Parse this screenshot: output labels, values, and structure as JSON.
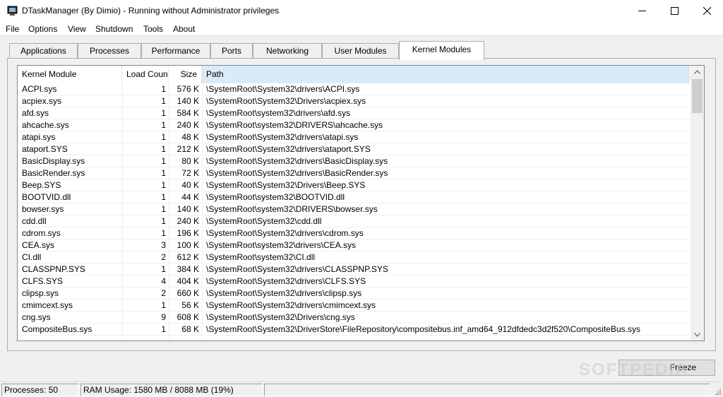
{
  "window": {
    "title": "DTaskManager (By Dimio) - Running without Administrator privileges",
    "icon": "app-icon"
  },
  "menu": [
    "File",
    "Options",
    "View",
    "Shutdown",
    "Tools",
    "About"
  ],
  "tabs": [
    "Applications",
    "Processes",
    "Performance",
    "Ports",
    "Networking",
    "User Modules",
    "Kernel Modules"
  ],
  "active_tab": "Kernel Modules",
  "list": {
    "columns": [
      "Kernel Module",
      "Load Count",
      "Size",
      "Path"
    ],
    "sorted_column": "Path",
    "rows": [
      [
        "ACPI.sys",
        "1",
        "576 K",
        "\\SystemRoot\\System32\\drivers\\ACPI.sys"
      ],
      [
        "acpiex.sys",
        "1",
        "140 K",
        "\\SystemRoot\\System32\\Drivers\\acpiex.sys"
      ],
      [
        "afd.sys",
        "1",
        "584 K",
        "\\SystemRoot\\system32\\drivers\\afd.sys"
      ],
      [
        "ahcache.sys",
        "1",
        "240 K",
        "\\SystemRoot\\system32\\DRIVERS\\ahcache.sys"
      ],
      [
        "atapi.sys",
        "1",
        "48 K",
        "\\SystemRoot\\System32\\drivers\\atapi.sys"
      ],
      [
        "ataport.SYS",
        "1",
        "212 K",
        "\\SystemRoot\\System32\\drivers\\ataport.SYS"
      ],
      [
        "BasicDisplay.sys",
        "1",
        "80 K",
        "\\SystemRoot\\System32\\drivers\\BasicDisplay.sys"
      ],
      [
        "BasicRender.sys",
        "1",
        "72 K",
        "\\SystemRoot\\System32\\drivers\\BasicRender.sys"
      ],
      [
        "Beep.SYS",
        "1",
        "40 K",
        "\\SystemRoot\\System32\\Drivers\\Beep.SYS"
      ],
      [
        "BOOTVID.dll",
        "1",
        "44 K",
        "\\SystemRoot\\system32\\BOOTVID.dll"
      ],
      [
        "bowser.sys",
        "1",
        "140 K",
        "\\SystemRoot\\system32\\DRIVERS\\bowser.sys"
      ],
      [
        "cdd.dll",
        "1",
        "240 K",
        "\\SystemRoot\\System32\\cdd.dll"
      ],
      [
        "cdrom.sys",
        "1",
        "196 K",
        "\\SystemRoot\\System32\\drivers\\cdrom.sys"
      ],
      [
        "CEA.sys",
        "3",
        "100 K",
        "\\SystemRoot\\system32\\drivers\\CEA.sys"
      ],
      [
        "CI.dll",
        "2",
        "612 K",
        "\\SystemRoot\\system32\\CI.dll"
      ],
      [
        "CLASSPNP.SYS",
        "1",
        "384 K",
        "\\SystemRoot\\System32\\drivers\\CLASSPNP.SYS"
      ],
      [
        "CLFS.SYS",
        "4",
        "404 K",
        "\\SystemRoot\\System32\\drivers\\CLFS.SYS"
      ],
      [
        "clipsp.sys",
        "2",
        "660 K",
        "\\SystemRoot\\System32\\drivers\\clipsp.sys"
      ],
      [
        "cmimcext.sys",
        "1",
        "56 K",
        "\\SystemRoot\\System32\\drivers\\cmimcext.sys"
      ],
      [
        "cng.sys",
        "9",
        "608 K",
        "\\SystemRoot\\System32\\Drivers\\cng.sys"
      ],
      [
        "CompositeBus.sys",
        "1",
        "68 K",
        "\\SystemRoot\\System32\\DriverStore\\FileRepository\\compositebus.inf_amd64_912dfdedc3d2f520\\CompositeBus.sys"
      ]
    ]
  },
  "buttons": {
    "freeze": "Freeze"
  },
  "watermark": "SOFTPEDIA",
  "status": {
    "processes": "Processes: 50",
    "ram": "RAM Usage:  1580 MB / 8088 MB (19%)",
    "extra": ""
  }
}
